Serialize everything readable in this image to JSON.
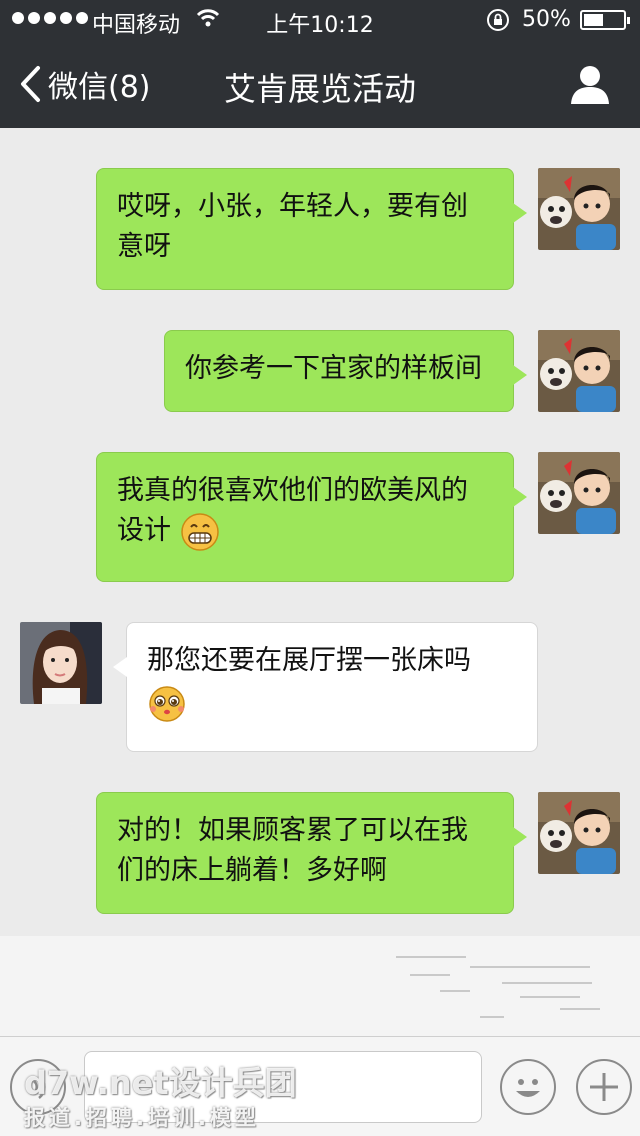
{
  "status_bar": {
    "carrier": "中国移动",
    "time": "上午10:12",
    "battery": "50%",
    "battery_level": 0.5,
    "icons": [
      "signal-dots-icon",
      "wifi-icon",
      "rotation-lock-icon",
      "battery-icon"
    ]
  },
  "nav": {
    "back_label": "微信(8)",
    "title": "艾肯展览活动",
    "right_icon": "person-icon"
  },
  "messages": [
    {
      "from": "me",
      "text": "哎呀，小张，年轻人，要有创意呀",
      "emoji": ""
    },
    {
      "from": "me",
      "text": "你参考一下宜家的样板间",
      "emoji": ""
    },
    {
      "from": "me",
      "text": "我真的很喜欢他们的欧美风的设计",
      "emoji": "grin-emoji"
    },
    {
      "from": "them",
      "text": "那您还要在展厅摆一张床吗",
      "emoji": "pleading-emoji"
    },
    {
      "from": "me",
      "text": "对的！如果顾客累了可以在我们的床上躺着！多好啊",
      "emoji": ""
    }
  ],
  "input_bar": {
    "icons": [
      "voice-icon",
      "smiley-icon",
      "plus-icon"
    ]
  },
  "watermark": {
    "line1": "d7w.net设计兵团",
    "line2": "报道.招聘.培训.模型"
  },
  "colors": {
    "nav_bg": "#2e3135",
    "chat_bg": "#ebebeb",
    "my_bubble": "#9de65a",
    "their_bubble": "#ffffff"
  }
}
